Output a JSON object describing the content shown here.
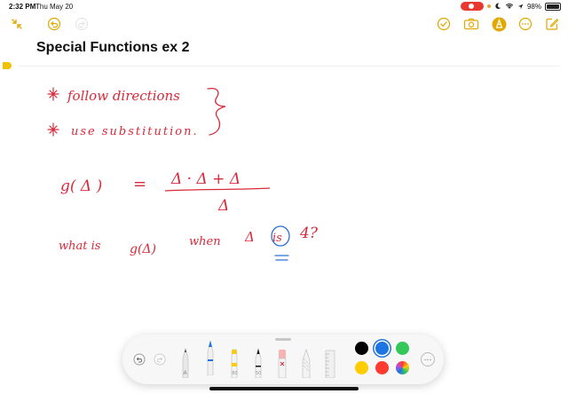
{
  "status_bar": {
    "time": "2:32 PM",
    "date": "Thu May 20",
    "battery": "98%"
  },
  "toolbar": {
    "left_icons": [
      "collapse-icon",
      "undo-icon",
      "redo-icon"
    ],
    "right_icons": [
      "checklist-icon",
      "camera-icon",
      "markup-pen-icon",
      "more-icon",
      "compose-icon"
    ],
    "accent_color": "#e0a800"
  },
  "note": {
    "title": "Special Functions ex 2",
    "handwriting": {
      "line1": "follow directions",
      "line2": "use substitution.",
      "formula_lhs": "g( Δ )",
      "equals": "=",
      "numerator": "Δ · Δ + Δ",
      "denominator": "Δ",
      "question_start": "what is",
      "question_func": "g(Δ)",
      "question_when": "when",
      "question_triangle": "Δ",
      "question_is": "is",
      "question_value": "4?"
    },
    "ink_colors": {
      "red": "#d92a3a",
      "blue": "#2a6fd6"
    }
  },
  "palette": {
    "tools": [
      "undo-icon",
      "redo-icon",
      "pencil-tool",
      "pen-tool",
      "highlighter-tool",
      "fineliner-tool",
      "eraser-tool",
      "lasso-tool",
      "ruler-tool"
    ],
    "colors": [
      "#000000",
      "#1e74e0",
      "#34c759",
      "#ffcc00",
      "#ff3b30",
      "multicolor"
    ],
    "selected_color": "#1e74e0",
    "more_label": "···"
  }
}
